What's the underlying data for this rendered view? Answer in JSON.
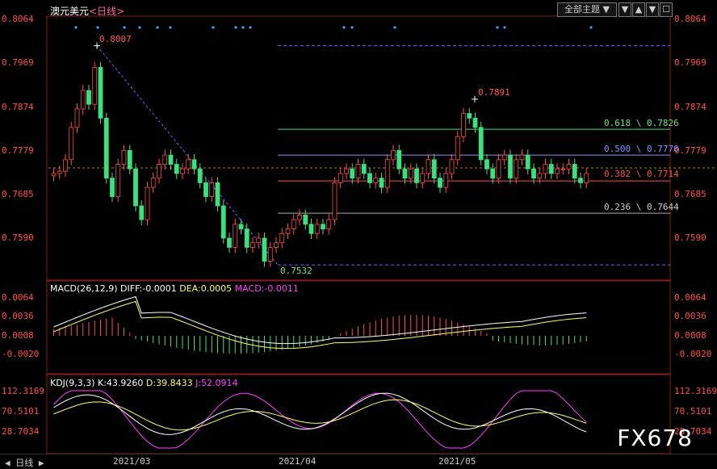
{
  "window": {
    "symbol": "澳元美元",
    "timeframe": "<日线>",
    "topic_select": "全部主题",
    "buttons": [
      "▼",
      "▲",
      "▼",
      "☐"
    ]
  },
  "colors": {
    "up": "#ff4e4e",
    "down": "#3be07f",
    "axis_text": "#ff4e4e",
    "dif": "#ffffff",
    "dea": "#ffff66",
    "macd_pos": "#ff4e4e",
    "macd_neg": "#3be07f",
    "k": "#ffffff",
    "d": "#ffff66",
    "j": "#ff40ff"
  },
  "price_axis": [
    "0.8064",
    "0.7969",
    "0.7874",
    "0.7779",
    "0.7685",
    "0.7590"
  ],
  "price_annotations": {
    "high": "0.8007",
    "low": "0.7532",
    "swing_high": "0.7891",
    "fib": [
      "0.618 \\ 0.7826",
      "0.500 \\ 0.7770",
      "0.382 \\ 0.7714",
      "0.236 \\ 0.7644"
    ]
  },
  "macd": {
    "header": "MACD(26,12,9)",
    "diff": "DIFF:-0.0001",
    "dea": "DEA:0.0005",
    "macd": "MACD:-0.0011",
    "axis": [
      "0.0064",
      "0.0036",
      "0.0008",
      "-0.0020"
    ]
  },
  "kdj": {
    "header": "KDJ(9,3,3)",
    "k": "K:43.9260",
    "d": "D:39.8433",
    "j": "J:52.0914",
    "axis": [
      "112.3169",
      "70.5101",
      "28.7034"
    ]
  },
  "dates": [
    "2021/03",
    "2021/04",
    "2021/05"
  ],
  "bottom_tab": "日线",
  "watermark": "FX678",
  "chart_data": {
    "type": "candlestick",
    "y_ticks": [
      0.8064,
      0.7969,
      0.7874,
      0.7779,
      0.7685,
      0.759
    ],
    "levels": {
      "high": 0.8007,
      "low": 0.7532,
      "fib_0_618": 0.7826,
      "fib_0_5": 0.777,
      "fib_0_382": 0.7714,
      "fib_0_236": 0.7644
    }
  }
}
